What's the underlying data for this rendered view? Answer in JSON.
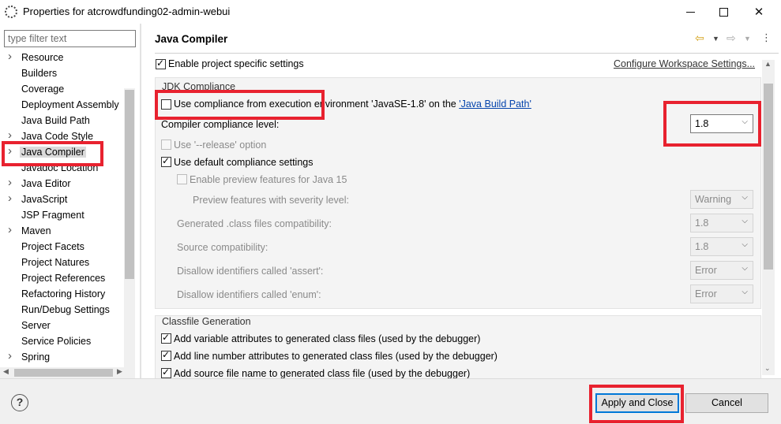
{
  "window": {
    "title": "Properties for atcrowdfunding02-admin-webui",
    "icon": "gear-icon"
  },
  "sidebar": {
    "filter_placeholder": "type filter text",
    "items": [
      {
        "label": "Resource",
        "expandable": true
      },
      {
        "label": "Builders",
        "expandable": false
      },
      {
        "label": "Coverage",
        "expandable": false
      },
      {
        "label": "Deployment Assembly",
        "expandable": false
      },
      {
        "label": "Java Build Path",
        "expandable": false
      },
      {
        "label": "Java Code Style",
        "expandable": true
      },
      {
        "label": "Java Compiler",
        "expandable": true,
        "selected": true
      },
      {
        "label": "Javadoc Location",
        "expandable": false
      },
      {
        "label": "Java Editor",
        "expandable": true
      },
      {
        "label": "JavaScript",
        "expandable": true
      },
      {
        "label": "JSP Fragment",
        "expandable": false
      },
      {
        "label": "Maven",
        "expandable": true
      },
      {
        "label": "Project Facets",
        "expandable": false
      },
      {
        "label": "Project Natures",
        "expandable": false
      },
      {
        "label": "Project References",
        "expandable": false
      },
      {
        "label": "Refactoring History",
        "expandable": false
      },
      {
        "label": "Run/Debug Settings",
        "expandable": false
      },
      {
        "label": "Server",
        "expandable": false
      },
      {
        "label": "Service Policies",
        "expandable": false
      },
      {
        "label": "Spring",
        "expandable": true
      }
    ]
  },
  "page": {
    "title": "Java Compiler",
    "enable_project_specific": "Enable project specific settings",
    "configure_workspace": "Configure Workspace Settings...",
    "jdk_group_title": "JDK Compliance",
    "use_compliance_prefix": "Use compliance from execution environment 'JavaSE-1.8' on the ",
    "java_build_path_link": "'Java Build Path'",
    "compliance_level_label": "Compiler compliance level:",
    "compliance_level_value": "1.8",
    "release_option": "Use '--release' option",
    "use_default_compliance": "Use default compliance settings",
    "enable_preview": "Enable preview features for Java 15",
    "preview_severity_label": "Preview features with severity level:",
    "preview_severity_value": "Warning",
    "class_compat_label": "Generated .class files compatibility:",
    "class_compat_value": "1.8",
    "source_compat_label": "Source compatibility:",
    "source_compat_value": "1.8",
    "assert_label": "Disallow identifiers called 'assert':",
    "assert_value": "Error",
    "enum_label": "Disallow identifiers called 'enum':",
    "enum_value": "Error",
    "classfile_group_title": "Classfile Generation",
    "add_variable_attrs": "Add variable attributes to generated class files (used by the debugger)",
    "add_line_number_attrs": "Add line number attributes to generated class files (used by the debugger)",
    "add_source_file_name": "Add source file name to generated class file (used by the debugger)"
  },
  "buttons": {
    "apply_close": "Apply and Close",
    "cancel": "Cancel",
    "help": "?"
  },
  "colors": {
    "highlight": "#e8222f",
    "link": "#0645ad",
    "default_button_border": "#0078d7"
  }
}
